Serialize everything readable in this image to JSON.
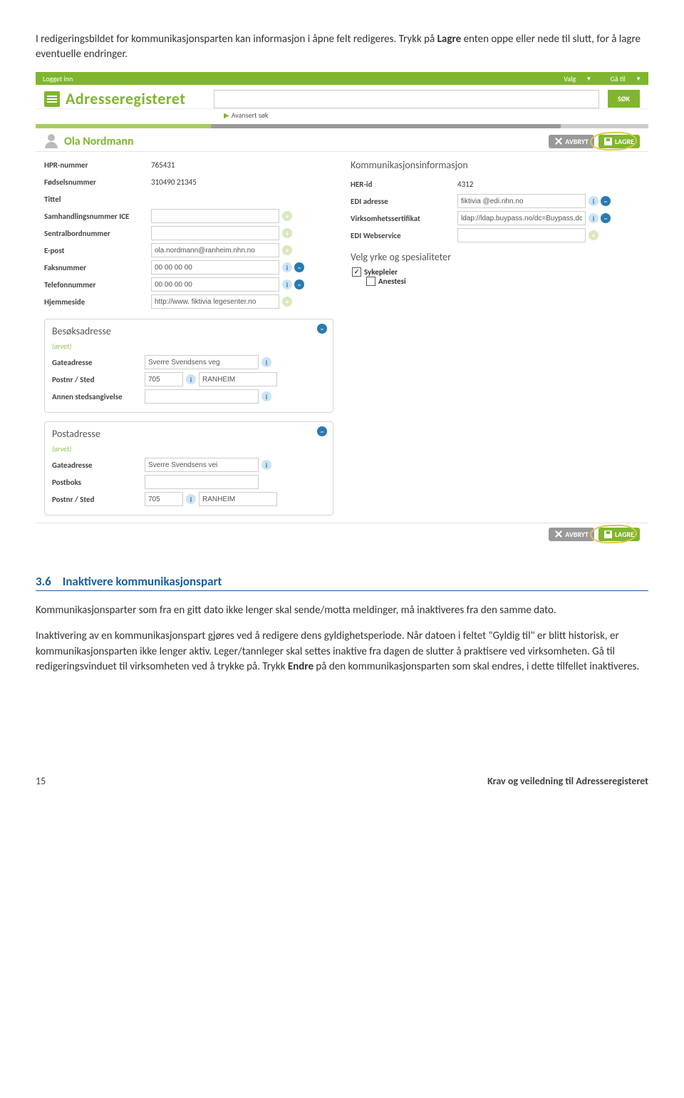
{
  "intro": {
    "p1a": "I redigeringsbildet for kommunikasjonsparten kan informasjon i åpne felt redigeres. Trykk på ",
    "p1b": "Lagre",
    "p1c": " enten oppe eller nede til slutt, for å lagre eventuelle endringer."
  },
  "topbar": {
    "left": "Logget inn",
    "valg": "Valg",
    "gaa": "Gå til"
  },
  "app": {
    "title": "Adresseregisteret",
    "sok": "SØK",
    "adv": "Avansert søk"
  },
  "user": {
    "name": "Ola Nordmann"
  },
  "actions": {
    "avbryt": "AVBRYT",
    "lagre": "LAGRE"
  },
  "left": {
    "hpr_l": "HPR-nummer",
    "hpr_v": "765431",
    "fnr_l": "Fødselsnummer",
    "fnr_v": "310490 21345",
    "tittel_l": "Tittel",
    "ice_l": "Samhandlingsnummer ICE",
    "sentral_l": "Sentralbordnummer",
    "epost_l": "E-post",
    "epost_v": "ola.nordmann@ranheim.nhn.no",
    "faks_l": "Faksnummer",
    "faks_v": "00 00 00 00",
    "tlf_l": "Telefonnummer",
    "tlf_v": "00 00 00 00",
    "hjemme_l": "Hjemmeside",
    "hjemme_v": "http://www. fiktivia legesenter.no"
  },
  "right": {
    "title": "Kommunikasjonsinformasjon",
    "her_l": "HER-id",
    "her_v": "4312",
    "edi_l": "EDI adresse",
    "edi_v": "fiktivia @edi.nhn.no",
    "virk_l": "Virksomhetssertifikat",
    "virk_v": "ldap://ldap.buypass.no/dc=Buypass,dc=no,CN=",
    "ediw_l": "EDI Webservice",
    "yrke_title": "Velg yrke og spesialiteter",
    "chk1": "Sykepleier",
    "chk2": "Anestesi"
  },
  "besok": {
    "title": "Besøksadresse",
    "arvet": "(arvet)",
    "gate_l": "Gateadresse",
    "gate_v": "Sverre Svendsens veg",
    "post_l": "Postnr / Sted",
    "post_nr": "705",
    "post_sted": "RANHEIM",
    "annen_l": "Annen stedsangivelse"
  },
  "post": {
    "title": "Postadresse",
    "arvet": "(arvet)",
    "gate_l": "Gateadresse",
    "gate_v": "Sverre Svendsens vei",
    "boks_l": "Postboks",
    "post_l": "Postnr / Sted",
    "post_nr": "705",
    "post_sted": "RANHEIM"
  },
  "section": {
    "num": "3.6",
    "title": "Inaktivere kommunikasjonspart",
    "p1": "Kommunikasjonsparter som fra en gitt dato ikke lenger skal sende/motta meldinger, må inaktiveres fra den samme dato.",
    "p2a": "Inaktivering av en kommunikasjonspart gjøres ved å redigere dens gyldighetsperiode. Når datoen i feltet \"Gyldig til\" er blitt historisk, er kommunikasjonsparten ikke lenger aktiv. Leger/tannleger skal settes inaktive fra dagen de slutter å praktisere ved virksomheten. Gå til redigeringsvinduet til virksomheten ved å trykke på. Trykk ",
    "p2b": "Endre",
    "p2c": " på den kommunikasjonsparten som skal endres, i dette tilfellet inaktiveres."
  },
  "footer": {
    "page": "15",
    "doc": "Krav og veiledning til Adresseregisteret"
  }
}
